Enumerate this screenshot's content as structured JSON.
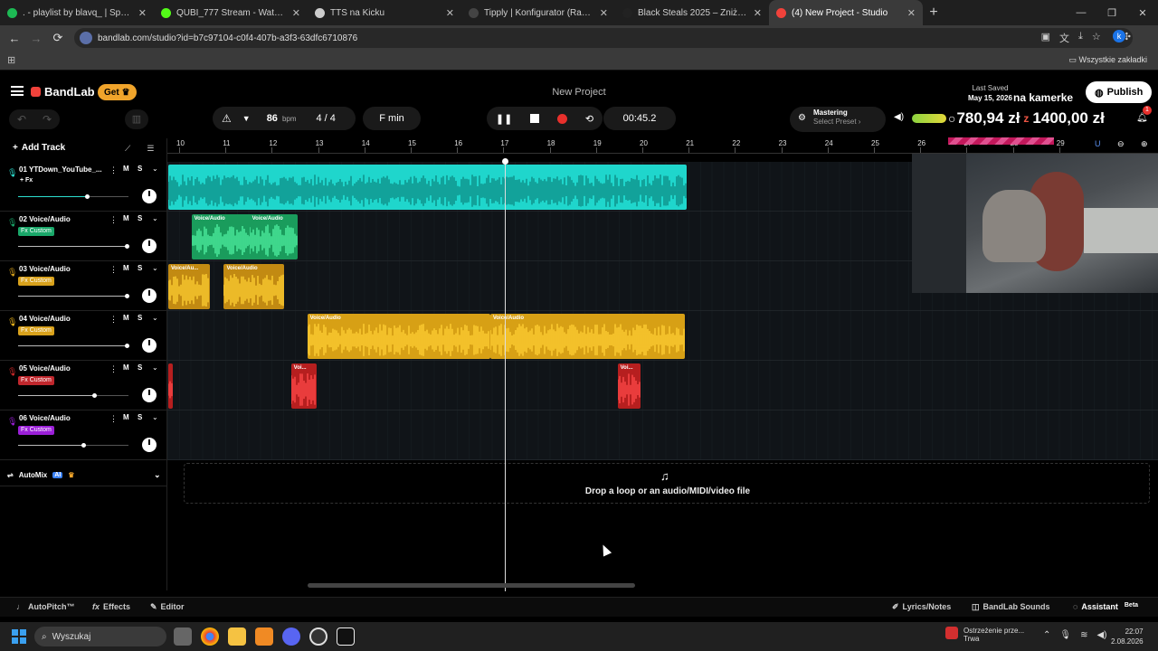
{
  "browser": {
    "tabs": [
      {
        "title": ". - playlist by blavq_ | Spotify",
        "color": "#1db954"
      },
      {
        "title": "QUBI_777 Stream - Watch Live",
        "color": "#53fc18"
      },
      {
        "title": "TTS na Kicku",
        "color": "#cccccc"
      },
      {
        "title": "Tipply | Konfigurator (Ranking w...",
        "color": "#444444"
      },
      {
        "title": "Black Steals 2025 – Zniżki do -8...",
        "color": "#222222"
      },
      {
        "title": "(4) New Project - Studio",
        "color": "#f0423b",
        "active": true
      }
    ],
    "url": "bandlab.com/studio?id=b7c97104-c0f4-407b-a3f3-63dfc6710876",
    "profile_letter": "k",
    "bookmarks_all": "Wszystkie zakładki"
  },
  "app": {
    "brand": "BandLab",
    "get_label": "Get",
    "project_name": "New Project",
    "last_saved_label": "Last Saved",
    "last_saved_date": "May 15, 2026",
    "overlay_camera": "na kamerke",
    "publish_label": "Publish"
  },
  "transport": {
    "bpm": "86",
    "bpm_label": "bpm",
    "signature": "4 / 4",
    "key": "F min",
    "time": "00:45.2",
    "mastering_label": "Mastering",
    "mastering_sub": "Select Preset",
    "donation_current": "780,94 zł",
    "donation_goal": "1400,00 zł",
    "notif_count": "1"
  },
  "sidebar": {
    "add_track": "Add Track",
    "automix_label": "AutoMix",
    "automix_badge": "AI"
  },
  "tracks": [
    {
      "name": "01  YTDown_YouTube_...",
      "fx": "+ Fx",
      "fx_style": "plain",
      "color": "#2de0d0",
      "mic_color": "#2de0d0",
      "vol": 0.62
    },
    {
      "name": "02  Voice/Audio",
      "fx": "Fx  Custom",
      "fx_style": "#1aa86a",
      "color": "#1aa86a",
      "mic_color": "#1aa86a",
      "vol": 0.98
    },
    {
      "name": "03  Voice/Audio",
      "fx": "Fx  Custom",
      "fx_style": "#d9a21c",
      "color": "#d9a21c",
      "mic_color": "#d9a21c",
      "vol": 0.98
    },
    {
      "name": "04  Voice/Audio",
      "fx": "Fx  Custom",
      "fx_style": "#d9a21c",
      "color": "#f0b81c",
      "mic_color": "#f0b81c",
      "vol": 0.98
    },
    {
      "name": "05  Voice/Audio",
      "fx": "Fx  Custom",
      "fx_style": "#c0272d",
      "color": "#d02a2a",
      "mic_color": "#d02a2a",
      "vol": 0.69
    },
    {
      "name": "06  Voice/Audio",
      "fx": "Fx  Custom",
      "fx_style": "#9b1fd8",
      "color": "#9b1fd8",
      "mic_color": "#9b1fd8",
      "vol": 0.59
    }
  ],
  "ruler": [
    "10",
    "11",
    "12",
    "13",
    "14",
    "15",
    "16",
    "17",
    "18",
    "19",
    "20",
    "21",
    "22",
    "23",
    "24",
    "25",
    "26",
    "27",
    "28",
    "29"
  ],
  "clips": [
    {
      "track": 0,
      "label": "",
      "start": 10.0,
      "end": 21.2,
      "color": "#1fd6cc"
    },
    {
      "track": 1,
      "label": "Voice/Audio",
      "start": 10.5,
      "end": 12.0,
      "color": "#1a9c5c"
    },
    {
      "track": 1,
      "label": "Voice/Audio",
      "start": 11.75,
      "end": 12.8,
      "color": "#1a9c5c"
    },
    {
      "track": 2,
      "label": "Voice/Au...",
      "start": 10.0,
      "end": 10.9,
      "color": "#c28a12"
    },
    {
      "track": 2,
      "label": "Voice/Audio",
      "start": 11.2,
      "end": 12.5,
      "color": "#c28a12"
    },
    {
      "track": 3,
      "label": "Voice/Audio",
      "start": 13.0,
      "end": 16.95,
      "color": "#d7a015"
    },
    {
      "track": 3,
      "label": "Voice/Audio",
      "start": 16.95,
      "end": 21.15,
      "color": "#d7a015"
    },
    {
      "track": 4,
      "label": "",
      "start": 10.0,
      "end": 10.1,
      "color": "#b61f1f"
    },
    {
      "track": 4,
      "label": "Voi...",
      "start": 12.65,
      "end": 13.2,
      "color": "#b61f1f"
    },
    {
      "track": 4,
      "label": "Voi...",
      "start": 19.7,
      "end": 20.2,
      "color": "#b61f1f"
    }
  ],
  "dropzone": "Drop a loop or an audio/MIDI/video file",
  "bottombar": {
    "autopitch": "AutoPitch™",
    "effects": "Effects",
    "editor": "Editor",
    "lyrics": "Lyrics/Notes",
    "sounds": "BandLab Sounds",
    "assistant": "Assistant",
    "beta": "Beta"
  },
  "taskbar": {
    "search": "Wyszukaj",
    "notice_title": "Ostrzeżenie prze...",
    "notice_sub": "Trwa",
    "time": "22:07",
    "date": "2.08.2026"
  }
}
